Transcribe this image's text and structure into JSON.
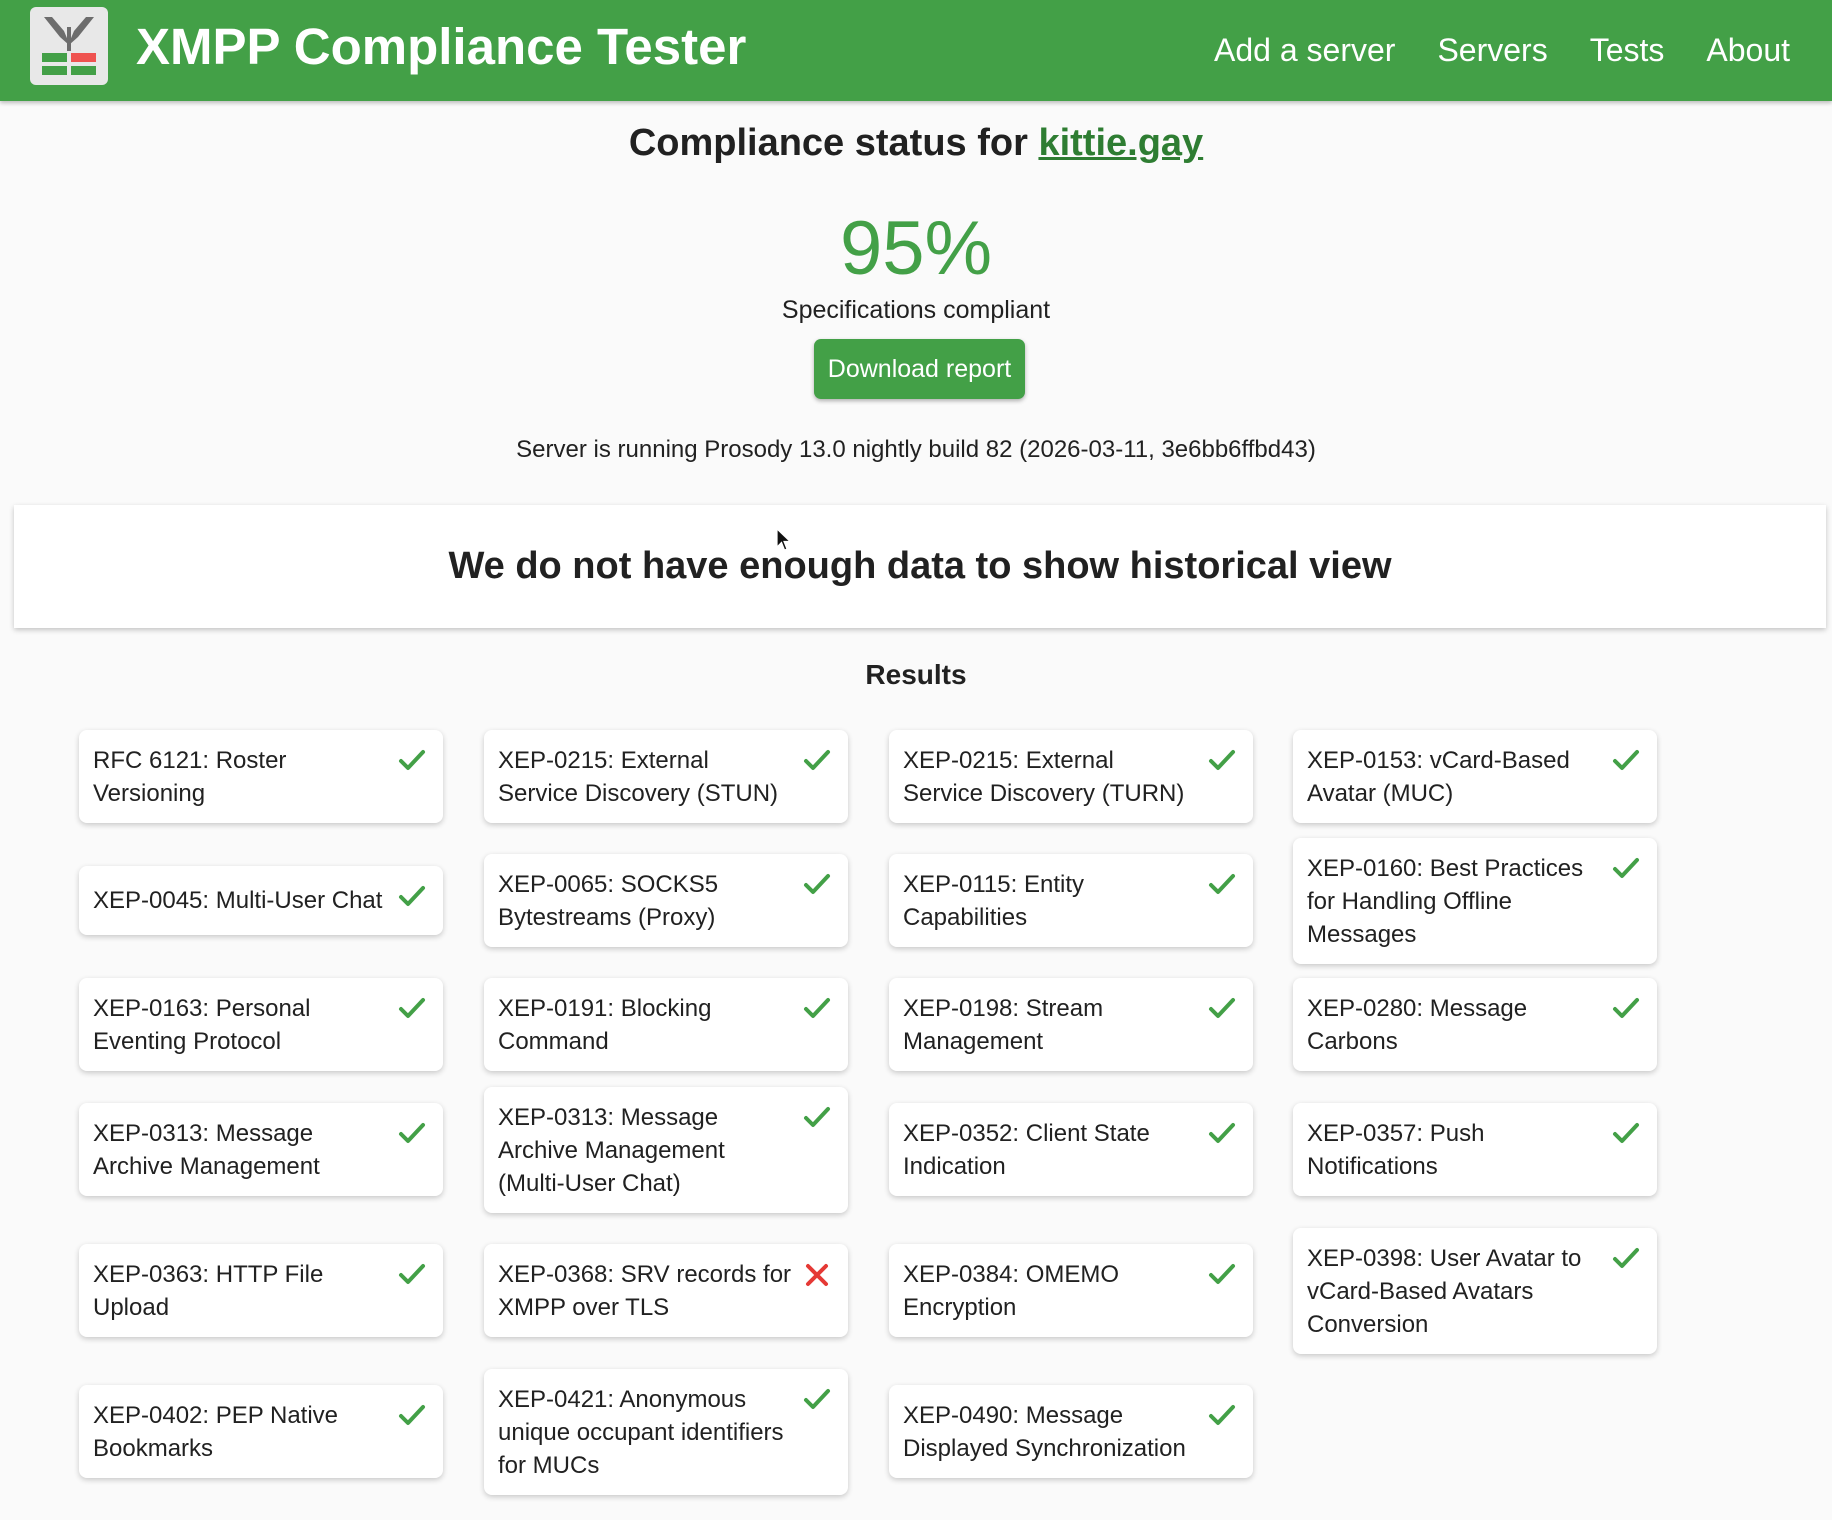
{
  "header": {
    "logo_icon": "xmpp-compliance-logo-icon",
    "title": "XMPP Compliance Tester",
    "nav": [
      "Add a server",
      "Servers",
      "Tests",
      "About"
    ]
  },
  "status": {
    "heading_prefix": "Compliance status for ",
    "domain": "kittie.gay",
    "percent": "95%",
    "percent_label": "Specifications compliant",
    "download_label": "Download report",
    "server_info": "Server is running Prosody 13.0 nightly build 82 (2026-03-11, 3e6bb6ffbd43)"
  },
  "history": {
    "message": "We do not have enough data to show historical view"
  },
  "results": {
    "title": "Results",
    "passed_icon": "checkmark-icon",
    "failed_icon": "cross-icon",
    "colors": {
      "pass": "#43a047",
      "fail": "#e53935"
    },
    "items": [
      {
        "label": "RFC 6121: Roster Versioning",
        "passed": true
      },
      {
        "label": "XEP-0215: External Service Discovery (STUN)",
        "passed": true
      },
      {
        "label": "XEP-0215: External Service Discovery (TURN)",
        "passed": true
      },
      {
        "label": "XEP-0153: vCard-Based Avatar (MUC)",
        "passed": true
      },
      {
        "label": "XEP-0045: Multi-User Chat",
        "passed": true
      },
      {
        "label": "XEP-0065: SOCKS5 Bytestreams (Proxy)",
        "passed": true
      },
      {
        "label": "XEP-0115: Entity Capabilities",
        "passed": true
      },
      {
        "label": "XEP-0160: Best Practices for Handling Offline Messages",
        "passed": true
      },
      {
        "label": "XEP-0163: Personal Eventing Protocol",
        "passed": true
      },
      {
        "label": "XEP-0191: Blocking Command",
        "passed": true
      },
      {
        "label": "XEP-0198: Stream Management",
        "passed": true
      },
      {
        "label": "XEP-0280: Message Carbons",
        "passed": true
      },
      {
        "label": "XEP-0313: Message Archive Management",
        "passed": true
      },
      {
        "label": "XEP-0313: Message Archive Management (Multi-User Chat)",
        "passed": true
      },
      {
        "label": "XEP-0352: Client State Indication",
        "passed": true
      },
      {
        "label": "XEP-0357: Push Notifications",
        "passed": true
      },
      {
        "label": "XEP-0363: HTTP File Upload",
        "passed": true
      },
      {
        "label": "XEP-0368: SRV records for XMPP over TLS",
        "passed": false
      },
      {
        "label": "XEP-0384: OMEMO Encryption",
        "passed": true
      },
      {
        "label": "XEP-0398: User Avatar to vCard-Based Avatars Conversion",
        "passed": true
      },
      {
        "label": "XEP-0402: PEP Native Bookmarks",
        "passed": true
      },
      {
        "label": "XEP-0421: Anonymous unique occupant identifiers for MUCs",
        "passed": true
      },
      {
        "label": "XEP-0490: Message Displayed Synchronization",
        "passed": true
      }
    ]
  }
}
